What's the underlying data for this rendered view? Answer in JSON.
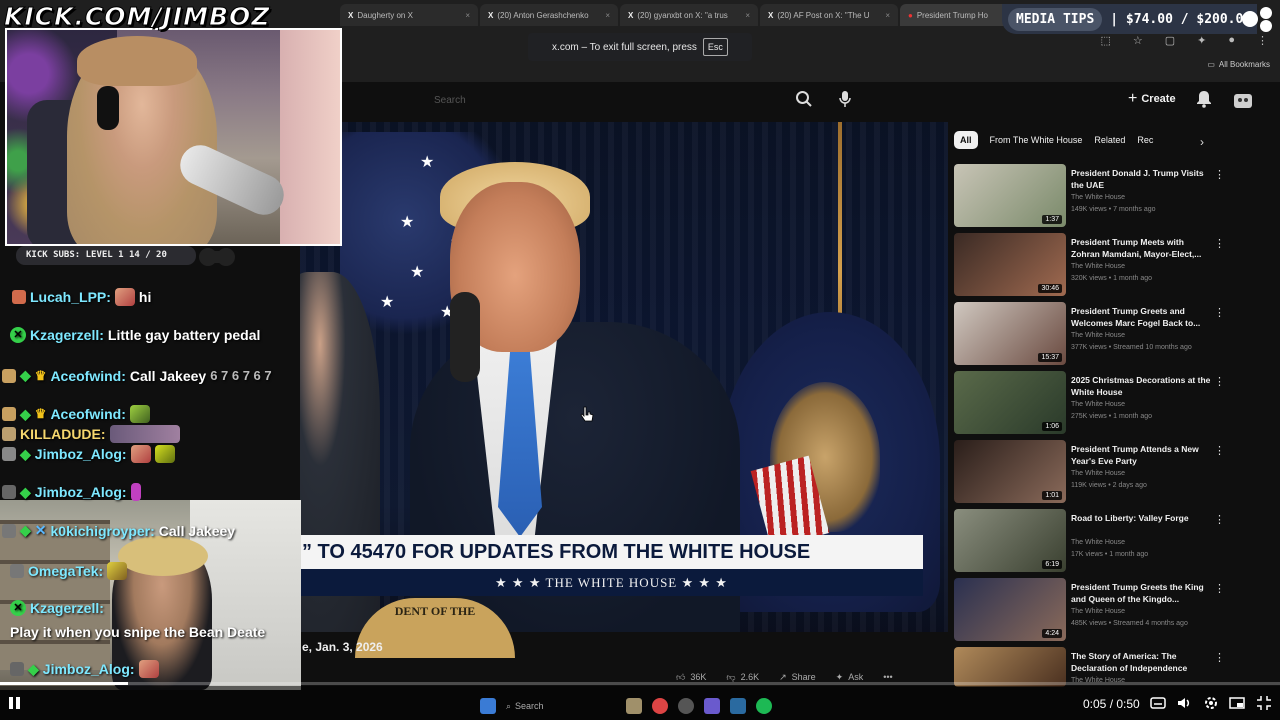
{
  "browser": {
    "tabs": [
      {
        "label": "Daugherty on X",
        "active": false
      },
      {
        "label": "(20) Anton Gerashchenko",
        "active": false
      },
      {
        "label": "(20) gyanxbt on X: \"a trus",
        "active": false
      },
      {
        "label": "(20) AF Post on X: \"The U",
        "active": false
      },
      {
        "label": "President Trump Ho",
        "active": true
      }
    ],
    "fullscreen_toast": {
      "text": "x.com – To exit full screen, press",
      "key": "Esc"
    },
    "bookmarks_label": "All Bookmarks"
  },
  "youtube": {
    "search_placeholder": "Search",
    "create_label": "Create",
    "lower_third": {
      "headline": "” TO 45470 FOR UPDATES FROM THE WHITE HOUSE",
      "banner": "★ ★ ★   THE WHITE HOUSE   ★ ★ ★"
    },
    "seal_text": "DENT OF THE",
    "video_date": "e, Jan. 3, 2026",
    "actions": {
      "likes": "36K",
      "dislikes": "2.6K",
      "share": "Share",
      "ask": "Ask",
      "more": "•••"
    },
    "chips": [
      "All",
      "From The White House",
      "Related",
      "Rec"
    ],
    "recommendations": [
      {
        "title": "President Donald J. Trump Visits the UAE",
        "channel": "The White House",
        "meta": "149K views • 7 months ago",
        "duration": "1:37",
        "thumb": "#9aa38c"
      },
      {
        "title": "President Trump Meets with Zohran Mamdani, Mayor-Elect,...",
        "channel": "The White House",
        "meta": "320K views • 1 month ago",
        "duration": "30:46",
        "thumb": "#7a5a4a"
      },
      {
        "title": "President Trump Greets and Welcomes Marc Fogel Back to...",
        "channel": "The White House",
        "meta": "377K views • Streamed 10 months ago",
        "duration": "15:37",
        "thumb": "#a08876"
      },
      {
        "title": "2025 Christmas Decorations at the White House",
        "channel": "The White House",
        "meta": "275K views • 1 month ago",
        "duration": "1:06",
        "thumb": "#3e5a3c"
      },
      {
        "title": "President Trump Attends a New Year's Eve Party",
        "channel": "The White House",
        "meta": "119K views • 2 days ago",
        "duration": "1:01",
        "thumb": "#4a3a34"
      },
      {
        "title": "Road to Liberty: Valley Forge",
        "channel": "The White House",
        "meta": "17K views • 1 month ago",
        "duration": "6:19",
        "thumb": "#6a6e5e"
      },
      {
        "title": "President Trump Greets the King and Queen of the Kingdo...",
        "channel": "The White House",
        "meta": "485K views • Streamed 4 months ago",
        "duration": "4:24",
        "thumb": "#4a5470"
      },
      {
        "title": "The Story of America: The Declaration of Independence",
        "channel": "The White House",
        "meta": "",
        "duration": "",
        "thumb": "#8a6a4a"
      }
    ]
  },
  "overlay": {
    "kick_url": "KICK.COM/JIMBOZ",
    "subs_bar": {
      "text": "KICK SUBS: LEVEL 1 14 / 20",
      "progress": 0.7
    },
    "media_tips": {
      "label": "MEDIA TIPS",
      "amount": "| $74.00 / $200.00"
    },
    "chat": [
      {
        "user": "Lucah_LPP:",
        "msg": "hi",
        "color": "cyan"
      },
      {
        "user": "Kzagerzell:",
        "msg": "Little gay battery pedal",
        "color": "cyan"
      },
      {
        "user": "Aceofwind:",
        "msg": "Call Jakeey",
        "color": "cyan"
      },
      {
        "user": "Aceofwind:",
        "msg": "",
        "color": "cyan"
      },
      {
        "user": "KILLADUDE:",
        "msg": "",
        "color": "yellow"
      },
      {
        "user": "Jimboz_Alog:",
        "msg": "",
        "color": "cyan"
      },
      {
        "user": "Jimboz_Alog:",
        "msg": "",
        "color": "cyan"
      },
      {
        "user": "k0kichigroyper:",
        "msg": "Call Jakeey",
        "color": "cyan"
      },
      {
        "user": "OmegaTek:",
        "msg": "",
        "color": "cyan"
      },
      {
        "user": "Kzagerzell:",
        "msg": "",
        "color": "cyan"
      },
      {
        "user": "",
        "msg": "Play it when you snipe the Bean Deate",
        "color": "cyan"
      },
      {
        "user": "Jimboz_Alog:",
        "msg": "",
        "color": "cyan"
      }
    ],
    "emote_text": "6 7  6 7  6 7"
  },
  "player": {
    "time": "0:05 / 0:50",
    "progress": 0.1,
    "taskbar_search": "Search"
  },
  "colors": {
    "accent_cyan": "#7ee8ff",
    "gem_green": "#35d04a",
    "yt_bg": "#0f0f0f"
  }
}
